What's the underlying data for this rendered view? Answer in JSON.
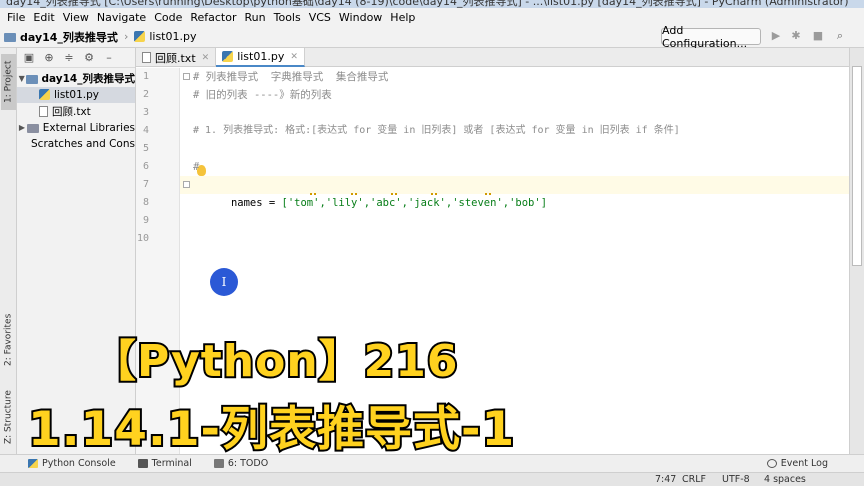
{
  "window": {
    "title": "day14_列表推导式 [C:\\Users\\running\\Desktop\\python基础\\day14 (8-19)\\code\\day14_列表推导式] - ...\\list01.py [day14_列表推导式] - PyCharm (Administrator)"
  },
  "menu": [
    "File",
    "Edit",
    "View",
    "Navigate",
    "Code",
    "Refactor",
    "Run",
    "Tools",
    "VCS",
    "Window",
    "Help"
  ],
  "breadcrumb": {
    "project": "day14_列表推导式",
    "file": "list01.py"
  },
  "toolbar": {
    "add_configuration": "Add Configuration..."
  },
  "left_tabs": {
    "project": "1: Project",
    "favorites": "2: Favorites",
    "structure": "Z: Structure"
  },
  "project_tree": [
    {
      "label": "day14_列表推导式",
      "type": "folder",
      "expanded": true
    },
    {
      "label": "list01.py",
      "type": "py",
      "selected": true
    },
    {
      "label": "回顾.txt",
      "type": "txt"
    },
    {
      "label": "External Libraries",
      "type": "lib"
    },
    {
      "label": "Scratches and Consoles",
      "type": "scratch"
    }
  ],
  "editor_tabs": [
    {
      "label": "回顾.txt",
      "active": false
    },
    {
      "label": "list01.py",
      "active": true
    }
  ],
  "line_numbers": [
    "1",
    "2",
    "3",
    "4",
    "5",
    "6",
    "7",
    "8",
    "9",
    "10"
  ],
  "code": {
    "line1": "# 列表推导式  字典推导式  集合推导式",
    "line2": "# 旧的列表 ----》新的列表",
    "line4": "# 1. 列表推导式: 格式:[表达式 for 变量 in 旧列表] 或者 [表达式 for 变量 in 旧列表 if 条件]",
    "line6": "#",
    "line7_prefix": "names = ",
    "line7_list": "['tom','lily','abc','jack','steven','bob']"
  },
  "bottom_tools": [
    {
      "label": "Python Console",
      "name": "python-console-tab"
    },
    {
      "label": "Terminal",
      "name": "terminal-tab"
    },
    {
      "label": "6: TODO",
      "name": "todo-tab"
    },
    {
      "label": "Event Log",
      "name": "event-log-tab"
    }
  ],
  "status": {
    "position": "7:47",
    "line_sep": "CRLF",
    "encoding": "UTF-8",
    "indent": "4 spaces"
  },
  "overlay": {
    "line1": "【Python】216",
    "line2": "1.14.1-列表推导式-1"
  },
  "cursor_glyph": "I",
  "colors": {
    "overlay_text": "#ffd21f",
    "string": "#067d17",
    "comment": "#8c8c8c",
    "cursor": "#2b59d6"
  }
}
